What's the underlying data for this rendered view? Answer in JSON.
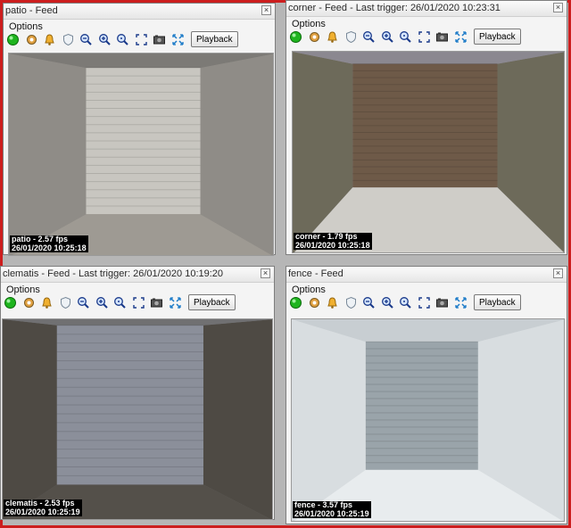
{
  "windows": [
    {
      "title": "patio - Feed",
      "menu": "Options",
      "playback_label": "Playback",
      "overlay": [
        "patio - 2.57 fps",
        "26/01/2020 10:25:18"
      ]
    },
    {
      "title": "corner - Feed - Last trigger: 26/01/2020 10:23:31",
      "menu": "Options",
      "playback_label": "Playback",
      "overlay": [
        "corner - 1.79 fps",
        "26/01/2020 10:25:18"
      ]
    },
    {
      "title": "clematis - Feed - Last trigger: 26/01/2020 10:19:20",
      "menu": "Options",
      "playback_label": "Playback",
      "overlay": [
        "clematis - 2.53 fps",
        "26/01/2020 10:25:19"
      ]
    },
    {
      "title": "fence - Feed",
      "menu": "Options",
      "playback_label": "Playback",
      "overlay": [
        "fence - 3.57 fps",
        "26/01/2020 10:25:19"
      ]
    }
  ],
  "close_glyph": "×",
  "toolbar_icons": [
    "status-green-icon",
    "settings-icon",
    "alert-bell-icon",
    "shield-icon",
    "zoom-out-icon",
    "zoom-in-icon",
    "zoom-reset-icon",
    "fit-frame-icon",
    "snapshot-icon",
    "fullscreen-icon"
  ],
  "colors": {
    "frame": "#cc1e1e",
    "status_green": "#1eb41e"
  }
}
